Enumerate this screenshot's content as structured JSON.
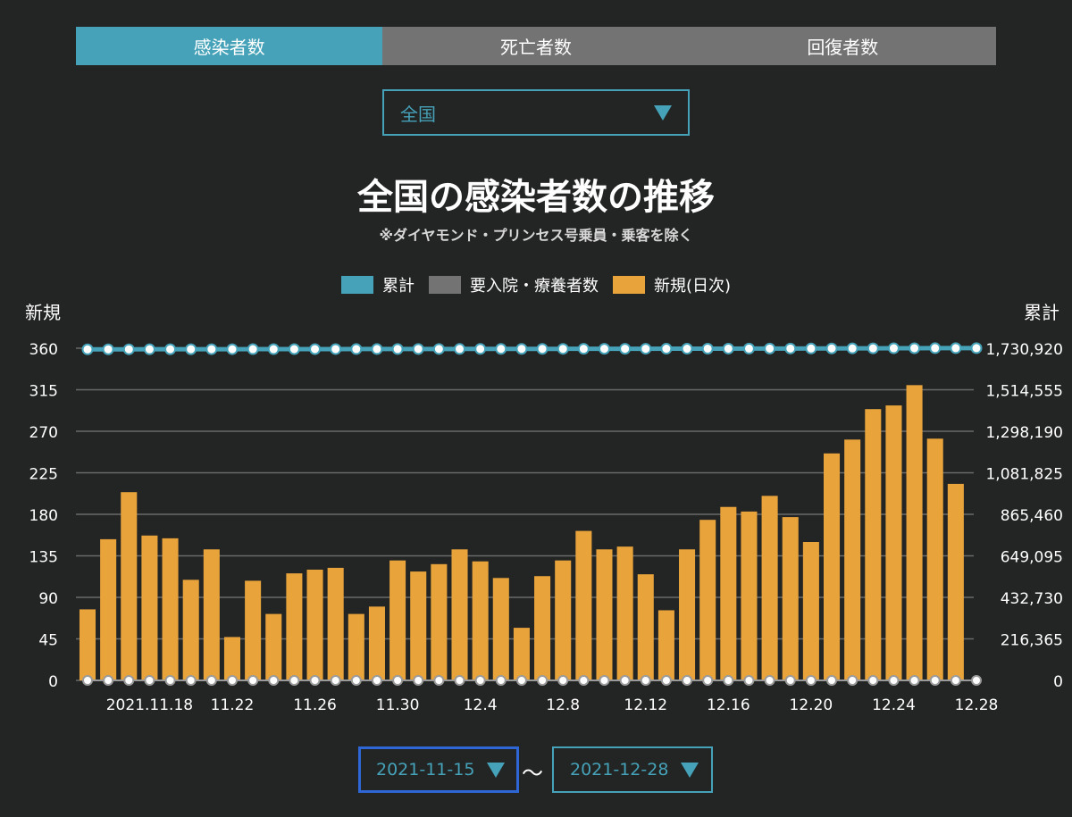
{
  "tabs": [
    {
      "label": "感染者数",
      "active": true
    },
    {
      "label": "死亡者数",
      "active": false
    },
    {
      "label": "回復者数",
      "active": false
    }
  ],
  "region_select": {
    "value": "全国"
  },
  "chart_title": "全国の感染者数の推移",
  "chart_subtitle": "※ダイヤモンド・プリンセス号乗員・乗客を除く",
  "legend": [
    {
      "label": "累計",
      "color": "#45a2b8"
    },
    {
      "label": "要入院・療養者数",
      "color": "#737373"
    },
    {
      "label": "新規(日次)",
      "color": "#e8a33b"
    }
  ],
  "left_axis_title": "新規",
  "right_axis_title": "累計",
  "date_range": {
    "from": "2021-11-15",
    "separator": "〜",
    "to": "2021-12-28"
  },
  "colors": {
    "accent": "#45a2b8",
    "bar": "#e8a33b",
    "inactive_tab": "#737373",
    "grid": "#6a6a6a"
  },
  "chart_data": {
    "type": "bar",
    "title": "全国の感染者数の推移",
    "subtitle": "※ダイヤモンド・プリンセス号乗員・乗客を除く",
    "y_left": {
      "label": "新規",
      "range": [
        0,
        360
      ],
      "ticks": [
        "0",
        "45",
        "90",
        "135",
        "180",
        "225",
        "270",
        "315",
        "360"
      ]
    },
    "y_right": {
      "label": "累計",
      "range": [
        0,
        1730920
      ],
      "ticks": [
        "0",
        "216,365",
        "432,730",
        "649,095",
        "865,460",
        "1,081,825",
        "1,298,190",
        "1,514,555",
        "1,730,920"
      ]
    },
    "x_tick_labels": [
      {
        "index": 3,
        "label": "2021.11.18"
      },
      {
        "index": 7,
        "label": "11.22"
      },
      {
        "index": 11,
        "label": "11.26"
      },
      {
        "index": 15,
        "label": "11.30"
      },
      {
        "index": 19,
        "label": "12.4"
      },
      {
        "index": 23,
        "label": "12.8"
      },
      {
        "index": 27,
        "label": "12.12"
      },
      {
        "index": 31,
        "label": "12.16"
      },
      {
        "index": 35,
        "label": "12.20"
      },
      {
        "index": 39,
        "label": "12.24"
      },
      {
        "index": 43,
        "label": "12.28"
      }
    ],
    "dates": [
      "11.15",
      "11.16",
      "11.17",
      "11.18",
      "11.19",
      "11.20",
      "11.21",
      "11.22",
      "11.23",
      "11.24",
      "11.25",
      "11.26",
      "11.27",
      "11.28",
      "11.29",
      "11.30",
      "12.1",
      "12.2",
      "12.3",
      "12.4",
      "12.5",
      "12.6",
      "12.7",
      "12.8",
      "12.9",
      "12.10",
      "12.11",
      "12.12",
      "12.13",
      "12.14",
      "12.15",
      "12.16",
      "12.17",
      "12.18",
      "12.19",
      "12.20",
      "12.21",
      "12.22",
      "12.23",
      "12.24",
      "12.25",
      "12.26",
      "12.27",
      "12.28"
    ],
    "series": [
      {
        "name": "新規(日次)",
        "axis": "left",
        "type": "bar",
        "values": [
          77,
          153,
          204,
          157,
          154,
          109,
          142,
          47,
          108,
          72,
          116,
          120,
          122,
          72,
          80,
          130,
          118,
          126,
          142,
          129,
          111,
          57,
          113,
          130,
          162,
          142,
          145,
          115,
          76,
          142,
          174,
          188,
          183,
          200,
          177,
          150,
          246,
          261,
          294,
          298,
          320,
          262,
          213,
          null
        ]
      },
      {
        "name": "累計",
        "axis": "right",
        "type": "line",
        "values": [
          1725000,
          1725150,
          1725360,
          1725510,
          1725670,
          1725780,
          1725920,
          1725970,
          1726070,
          1726150,
          1726260,
          1726380,
          1726500,
          1726570,
          1726650,
          1726780,
          1726900,
          1727030,
          1727170,
          1727300,
          1727410,
          1727470,
          1727580,
          1727710,
          1727870,
          1728010,
          1728160,
          1728270,
          1728350,
          1728490,
          1728670,
          1728850,
          1729040,
          1729240,
          1729410,
          1729560,
          1729810,
          1730070,
          1730360,
          1730660,
          1730980,
          1731240,
          1731450,
          1731450
        ]
      },
      {
        "name": "要入院・療養者数",
        "axis": "right",
        "type": "line",
        "values": [
          0,
          0,
          0,
          0,
          0,
          0,
          0,
          0,
          0,
          0,
          0,
          0,
          0,
          0,
          0,
          0,
          0,
          0,
          0,
          0,
          0,
          0,
          0,
          0,
          0,
          0,
          0,
          0,
          0,
          0,
          0,
          0,
          0,
          0,
          0,
          0,
          0,
          0,
          0,
          0,
          0,
          0,
          0,
          0
        ]
      }
    ],
    "grid": true,
    "legend_position": "top-center"
  }
}
